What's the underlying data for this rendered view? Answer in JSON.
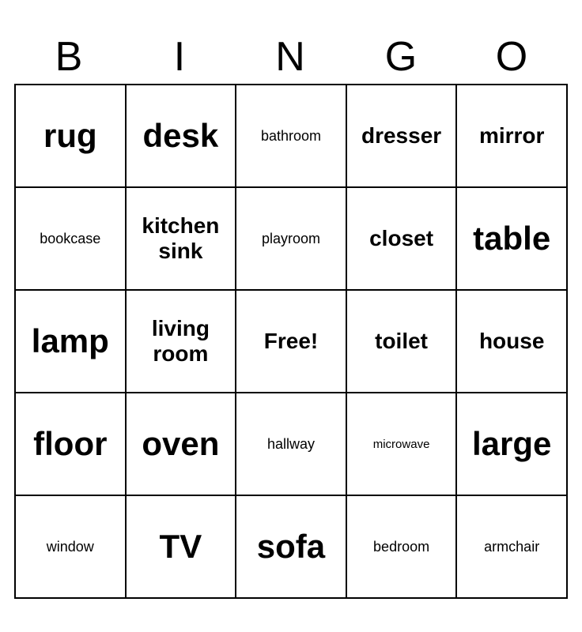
{
  "header": {
    "letters": [
      "B",
      "I",
      "N",
      "G",
      "O"
    ]
  },
  "grid": {
    "rows": [
      [
        {
          "text": "rug",
          "size": "large"
        },
        {
          "text": "desk",
          "size": "large"
        },
        {
          "text": "bathroom",
          "size": "small"
        },
        {
          "text": "dresser",
          "size": "medium"
        },
        {
          "text": "mirror",
          "size": "medium"
        }
      ],
      [
        {
          "text": "bookcase",
          "size": "small"
        },
        {
          "text": "kitchen sink",
          "size": "medium"
        },
        {
          "text": "playroom",
          "size": "small"
        },
        {
          "text": "closet",
          "size": "medium"
        },
        {
          "text": "table",
          "size": "large"
        }
      ],
      [
        {
          "text": "lamp",
          "size": "large"
        },
        {
          "text": "living room",
          "size": "medium"
        },
        {
          "text": "Free!",
          "size": "medium"
        },
        {
          "text": "toilet",
          "size": "medium"
        },
        {
          "text": "house",
          "size": "medium"
        }
      ],
      [
        {
          "text": "floor",
          "size": "large"
        },
        {
          "text": "oven",
          "size": "large"
        },
        {
          "text": "hallway",
          "size": "small"
        },
        {
          "text": "microwave",
          "size": "xsmall"
        },
        {
          "text": "large",
          "size": "large"
        }
      ],
      [
        {
          "text": "window",
          "size": "small"
        },
        {
          "text": "TV",
          "size": "large"
        },
        {
          "text": "sofa",
          "size": "large"
        },
        {
          "text": "bedroom",
          "size": "small"
        },
        {
          "text": "armchair",
          "size": "small"
        }
      ]
    ]
  }
}
